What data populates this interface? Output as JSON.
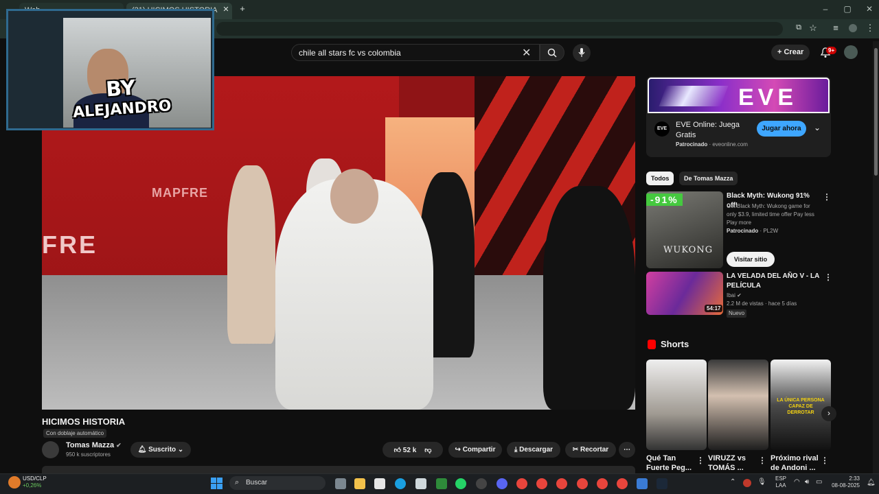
{
  "browser": {
    "tabs": [
      {
        "label": "Web..."
      },
      {
        "label": "(21) HICIMOS HISTORIA"
      }
    ],
    "new_tab_icon": "plus-icon"
  },
  "header": {
    "search_value": "chile all stars fc vs colombia",
    "create_label": "Crear",
    "notification_count": "9+"
  },
  "webcam": {
    "overlay_line1": "BY",
    "overlay_line2": "ALEJANDRO"
  },
  "video": {
    "title": "HICIMOS HISTORIA",
    "dub_label": "Con doblaje automático",
    "channel_name": "Tomas Mazza",
    "subscribers": "950 k suscriptores",
    "subscribed_label": "Suscrito",
    "likes": "52 k",
    "share_label": "Compartir",
    "download_label": "Descargar",
    "clip_label": "Recortar",
    "wall_text_1": "MAPFRE",
    "wall_text_2": "FRE"
  },
  "sidebar": {
    "ad": {
      "brand": "EVE",
      "title": "EVE Online: Juega Gratis",
      "sponsored": "Patrocinado",
      "domain": "eveonline.com",
      "cta": "Jugar ahora",
      "logo_text": "EVE"
    },
    "chips": [
      "Todos",
      "De Tomas Mazza"
    ],
    "recommendations": [
      {
        "title": "Black Myth: Wukong 91% off!",
        "desc": "Get Black Myth: Wukong game for only $3.9, limited time offer Pay less Play more",
        "sponsored": "Patrocinado",
        "source": "PL2W",
        "discount": "-91%",
        "thumb_text": "WUKONG",
        "cta": "Visitar sitio"
      },
      {
        "title": "LA VELADA DEL AÑO V - LA PELÍCULA",
        "channel": "Ibai",
        "meta": "2.2 M de vistas · hace 5 días",
        "badge": "Nuevo",
        "duration": "54:17"
      }
    ],
    "shorts_heading": "Shorts",
    "shorts": [
      {
        "title": "Qué Tan Fuerte Peg..."
      },
      {
        "title": "VIRUZZ vs TOMÁS ..."
      },
      {
        "title": "Próximo rival de Andoni ...",
        "thumb_text": "LA ÚNICA PERSONA CAPAZ DE DERROTAR"
      }
    ]
  },
  "taskbar": {
    "ticker_name": "USD/CLP",
    "ticker_change": "+0,26%",
    "search_label": "Buscar",
    "lang_1": "ESP",
    "lang_2": "LAA",
    "time": "2:33",
    "date": "08-08-2025"
  },
  "colors": {
    "accent": "#3ea6ff",
    "brand_red": "#ff0000",
    "discount_green": "#45c93f"
  }
}
